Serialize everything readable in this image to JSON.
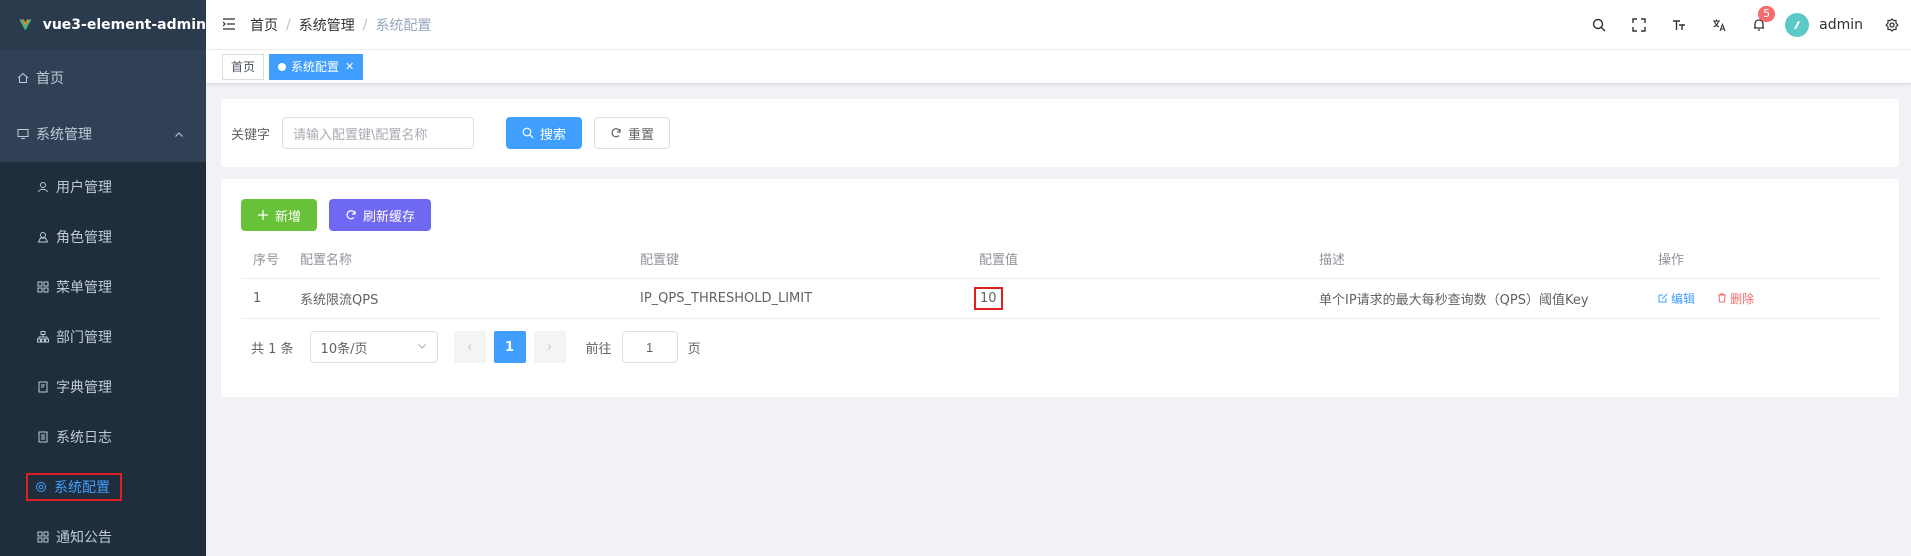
{
  "app": {
    "title": "vue3-element-admin"
  },
  "sidebar": {
    "home": "首页",
    "group": "系统管理",
    "items": [
      {
        "label": "用户管理",
        "icon": "user-icon"
      },
      {
        "label": "角色管理",
        "icon": "role-icon"
      },
      {
        "label": "菜单管理",
        "icon": "menu-icon"
      },
      {
        "label": "部门管理",
        "icon": "tree-icon"
      },
      {
        "label": "字典管理",
        "icon": "dict-icon"
      },
      {
        "label": "系统日志",
        "icon": "document-icon"
      },
      {
        "label": "系统配置",
        "icon": "setting-icon",
        "active": true
      },
      {
        "label": "通知公告",
        "icon": "grid-icon"
      }
    ]
  },
  "header": {
    "breadcrumb": [
      "首页",
      "系统管理",
      "系统配置"
    ],
    "notify_count": "5",
    "username": "admin"
  },
  "tags": [
    "首页",
    "系统配置"
  ],
  "search": {
    "label": "关键字",
    "placeholder": "请输入配置键\\配置名称",
    "search_btn": "搜索",
    "reset_btn": "重置"
  },
  "toolbar": {
    "add_btn": "新增",
    "refresh_btn": "刷新缓存"
  },
  "table": {
    "columns": [
      "序号",
      "配置名称",
      "配置键",
      "配置值",
      "描述",
      "操作"
    ],
    "rows": [
      {
        "index": "1",
        "name": "系统限流QPS",
        "key": "IP_QPS_THRESHOLD_LIMIT",
        "value": "10",
        "desc": "单个IP请求的最大每秒查询数（QPS）阈值Key",
        "edit": "编辑",
        "delete": "删除"
      }
    ]
  },
  "pagination": {
    "total": "共 1 条",
    "page_size": "10条/页",
    "current": "1",
    "goto_label": "前往",
    "goto_value": "1",
    "page_unit": "页"
  },
  "colors": {
    "primary": "#409eff",
    "sidebar": "#304156",
    "success": "#67c23a",
    "purple": "#6f68f2",
    "danger": "#f56c6c"
  }
}
